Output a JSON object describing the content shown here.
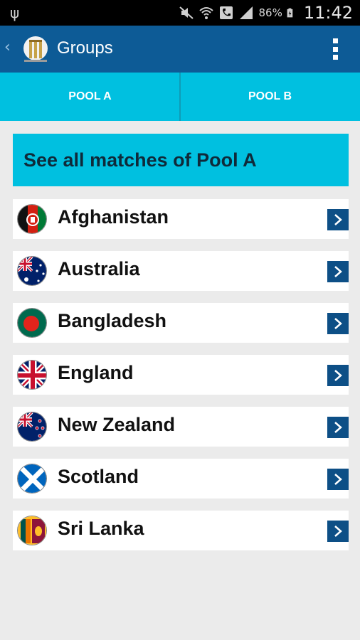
{
  "status_bar": {
    "battery_text": "86%",
    "time": "11:42",
    "icons": [
      "usb-icon",
      "mute-icon",
      "wifi-icon",
      "phone-icon",
      "signal-icon",
      "battery-icon"
    ]
  },
  "app_bar": {
    "title": "Groups",
    "icons": [
      "back-chevron-icon",
      "cricket-stumps-logo-icon",
      "overflow-menu-icon"
    ]
  },
  "tabs": [
    {
      "label": "POOL A",
      "selected": true
    },
    {
      "label": "POOL B",
      "selected": false
    }
  ],
  "banner": {
    "label": "See all matches of Pool A"
  },
  "teams": [
    {
      "name": "Afghanistan",
      "flag_icon": "afghanistan-flag-icon"
    },
    {
      "name": "Australia",
      "flag_icon": "australia-flag-icon"
    },
    {
      "name": "Bangladesh",
      "flag_icon": "bangladesh-flag-icon"
    },
    {
      "name": "England",
      "flag_icon": "england-flag-icon"
    },
    {
      "name": "New Zealand",
      "flag_icon": "new-zealand-flag-icon"
    },
    {
      "name": "Scotland",
      "flag_icon": "scotland-flag-icon"
    },
    {
      "name": "Sri Lanka",
      "flag_icon": "sri-lanka-flag-icon"
    }
  ],
  "colors": {
    "app_bar": "#0d5b96",
    "accent": "#00c0e0",
    "chevron_box": "#0d4f86",
    "background": "#ebebeb"
  }
}
